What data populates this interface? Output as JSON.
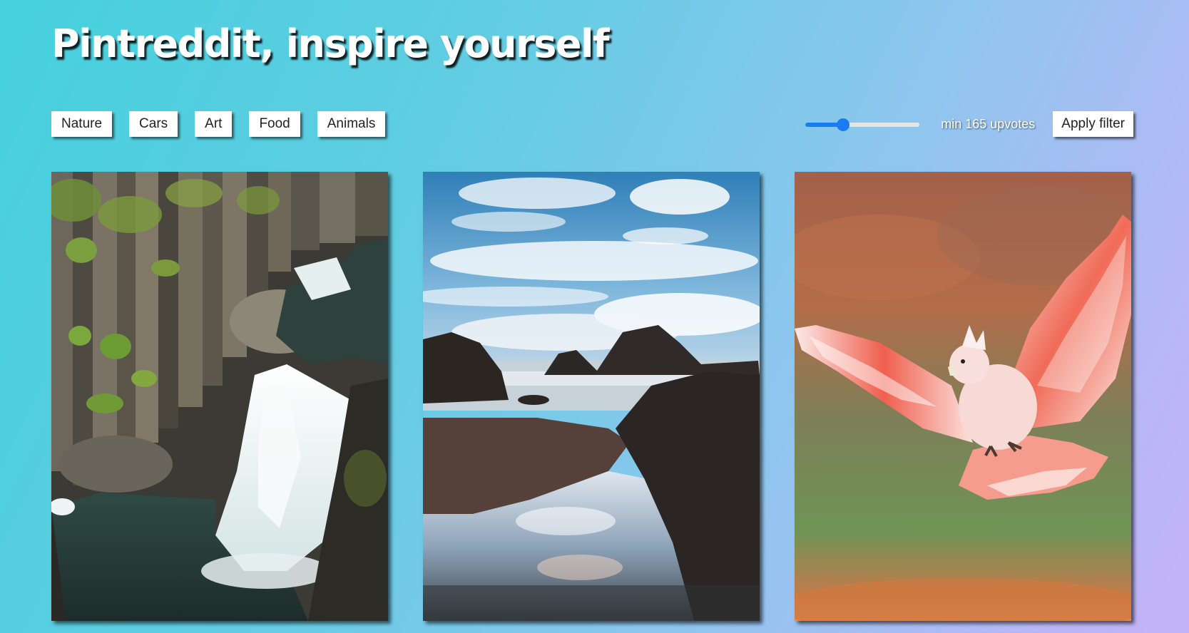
{
  "header": {
    "title": "Pintreddit, inspire yourself"
  },
  "categories": [
    {
      "label": "Nature"
    },
    {
      "label": "Cars"
    },
    {
      "label": "Art"
    },
    {
      "label": "Food"
    },
    {
      "label": "Animals"
    }
  ],
  "filter": {
    "min_upvotes": 165,
    "slider_level": 0.33,
    "upvotes_text": "min 165 upvotes",
    "apply_label": "Apply filter",
    "accent_color": "#1b7cf2"
  },
  "gallery": [
    {
      "subject": "waterfall-basalt-columns"
    },
    {
      "subject": "rocky-coast-tide-pool"
    },
    {
      "subject": "pink-cockatoo-in-flight"
    }
  ]
}
